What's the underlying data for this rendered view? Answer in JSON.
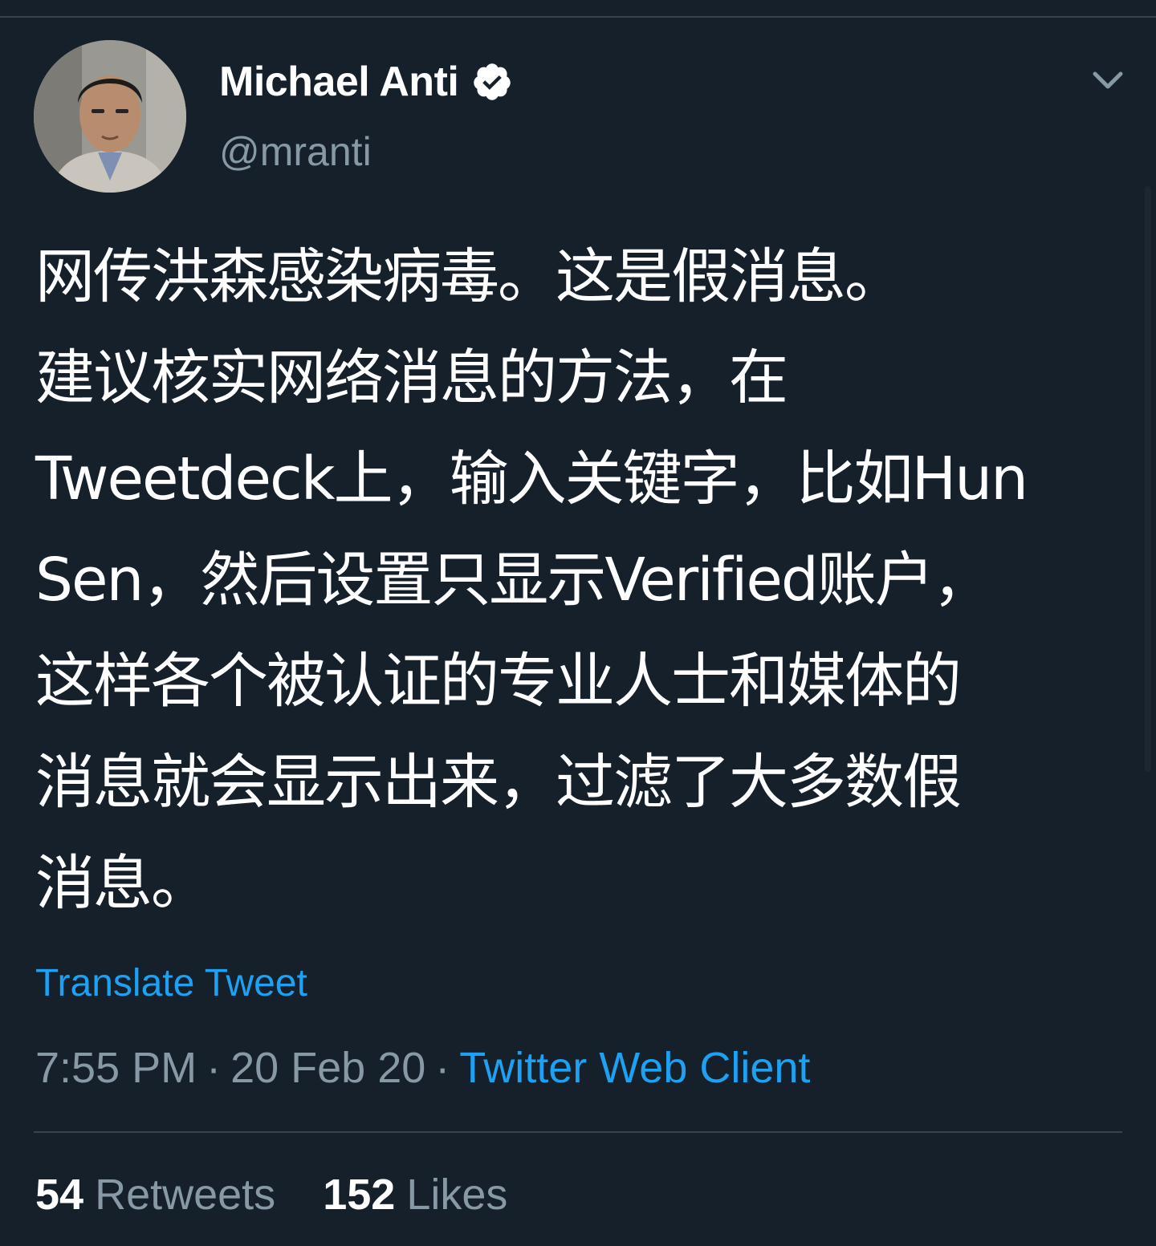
{
  "tweet": {
    "author": {
      "display_name": "Michael Anti",
      "handle": "@mranti",
      "verified": true
    },
    "text_lines": [
      "网传洪森感染病毒。这是假消息。",
      "建议核实网络消息的方法，在",
      "Tweetdeck上，输入关键字，比如Hun",
      "Sen，然后设置只显示Verified账户，",
      "这样各个被认证的专业人士和媒体的",
      "消息就会显示出来，过滤了大多数假",
      "消息。"
    ],
    "translate_label": "Translate Tweet",
    "time": "7:55 PM",
    "separator": "·",
    "date": "20 Feb 20",
    "source": "Twitter Web Client",
    "retweets": {
      "count": "54",
      "label": "Retweets"
    },
    "likes": {
      "count": "152",
      "label": "Likes"
    }
  },
  "icons": {
    "verified": "verified-badge-icon",
    "caret": "chevron-down-icon"
  },
  "colors": {
    "background": "#15202b",
    "divider": "#38444d",
    "primary_text": "#ffffff",
    "secondary_text": "#8899a6",
    "accent": "#1da1f2"
  }
}
